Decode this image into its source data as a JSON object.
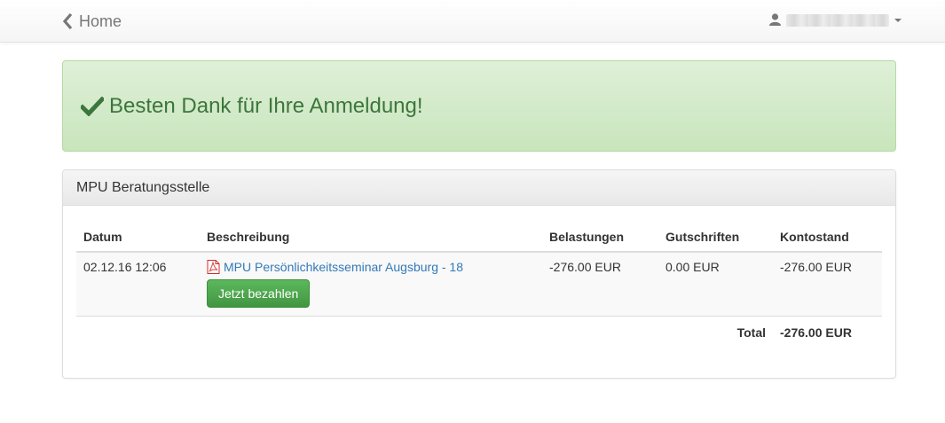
{
  "navbar": {
    "home_label": "Home",
    "home_icon": "chevron-left-icon",
    "user_icon": "user-icon",
    "user_name": ""
  },
  "alert": {
    "icon": "checkmark-icon",
    "message": "Besten Dank für Ihre Anmeldung!",
    "color": "#3c763d"
  },
  "panel": {
    "title": "MPU Beratungsstelle",
    "columns": {
      "datum": "Datum",
      "beschreibung": "Beschreibung",
      "belastungen": "Belastungen",
      "gutschriften": "Gutschriften",
      "kontostand": "Kontostand"
    },
    "rows": [
      {
        "datum": "02.12.16 12:06",
        "beschreibung": "MPU Persönlichkeitsseminar Augsburg - 18",
        "doc_icon": "pdf-icon",
        "button_label": "Jetzt bezahlen",
        "belastungen": "-276.00 EUR",
        "gutschriften": "0.00 EUR",
        "kontostand": "-276.00 EUR"
      }
    ],
    "total_label": "Total",
    "total_value": "-276.00 EUR"
  },
  "colors": {
    "link": "#337ab7",
    "success_button": "#5cb85c",
    "alert_bg": "#dff0d8"
  }
}
